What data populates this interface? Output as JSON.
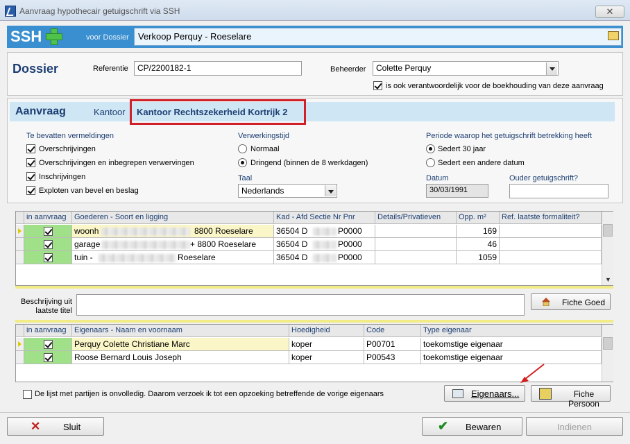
{
  "window": {
    "title": "Aanvraag hypothecair getuigschrift via SSH",
    "close_glyph": "✕"
  },
  "header": {
    "logo": "SSH",
    "voor_label": "voor Dossier",
    "dossier_value": "Verkoop  Perquy - Roeselare"
  },
  "dossier": {
    "title": "Dossier",
    "referentie_label": "Referentie",
    "referentie_value": "CP/2200182-1",
    "beheerder_label": "Beheerder",
    "beheerder_value": "Colette Perquy",
    "boekhouding_label": "is ook verantwoordelijk voor de boekhouding van deze aanvraag",
    "boekhouding_checked": true
  },
  "aanvraag": {
    "title": "Aanvraag",
    "kantoor_label": "Kantoor",
    "kantoor_value": "Kantoor Rechtszekerheid Kortrijk 2",
    "highlight_color": "#d0202a",
    "vermeldingen": {
      "title": "Te bevatten vermeldingen",
      "items": [
        {
          "label": "Overschrijvingen",
          "checked": true
        },
        {
          "label": "Overschrijvingen en inbegrepen verwervingen",
          "checked": true
        },
        {
          "label": "Inschrijvingen",
          "checked": true
        },
        {
          "label": "Exploten van bevel en beslag",
          "checked": true
        }
      ]
    },
    "verwerking": {
      "title": "Verwerkingstijd",
      "options": [
        {
          "label": "Normaal",
          "selected": false
        },
        {
          "label": "Dringend (binnen de 8 werkdagen)",
          "selected": true
        }
      ]
    },
    "taal": {
      "label": "Taal",
      "value": "Nederlands"
    },
    "periode": {
      "title": "Periode waarop het getuigschrift betrekking heeft",
      "options": [
        {
          "label": "Sedert 30 jaar",
          "selected": true
        },
        {
          "label": "Sedert een andere datum",
          "selected": false
        }
      ]
    },
    "datum": {
      "label": "Datum",
      "value": "30/03/1991"
    },
    "ouder": {
      "label": "Ouder getuigschrift?",
      "value": ""
    }
  },
  "goederen": {
    "columns": [
      "in aanvraag",
      "Goederen - Soort en ligging",
      "Kad - Afd Sectie Nr Pnr",
      "Details/Privatieven",
      "Opp. m²",
      "Ref. laatste formaliteit?"
    ],
    "rows": [
      {
        "checked": true,
        "soort": "woonh",
        "ligging": "8800 Roeselare",
        "kad": "36504 D",
        "pnr": "P0000",
        "details": "",
        "opp": "169",
        "ref": "",
        "current": true
      },
      {
        "checked": true,
        "soort": "garage",
        "ligging": "+  8800 Roeselare",
        "kad": "36504 D",
        "pnr": "P0000",
        "details": "",
        "opp": "46",
        "ref": "",
        "current": false
      },
      {
        "checked": true,
        "soort": "tuin  -",
        "ligging": "Roeselare",
        "kad": "36504 D",
        "pnr": "P0000",
        "details": "",
        "opp": "1059",
        "ref": "",
        "current": false
      }
    ]
  },
  "beschrijving": {
    "label_line1": "Beschrijving uit",
    "label_line2": "laatste titel",
    "value": "",
    "fiche_goed": "Fiche Goed"
  },
  "eigenaars": {
    "columns": [
      "in aanvraag",
      "Eigenaars - Naam en voornaam",
      "Hoedigheid",
      "Code",
      "Type eigenaar"
    ],
    "rows": [
      {
        "checked": true,
        "naam": "Perquy Colette Christiane Marc",
        "hoedigheid": "koper",
        "code": "P00701",
        "type": "toekomstige eigenaar",
        "current": true
      },
      {
        "checked": true,
        "naam": "Roose Bernard Louis Joseph",
        "hoedigheid": "koper",
        "code": "P00543",
        "type": "toekomstige eigenaar",
        "current": false
      }
    ],
    "onvolledig_label": "De lijst met partijen is onvolledig. Daarom verzoek ik tot een opzoeking betreffende de vorige eigenaars",
    "onvolledig_checked": false,
    "eigenaars_button": "Eigenaars...",
    "fiche_persoon": "Fiche Persoon"
  },
  "footer": {
    "sluit": "Sluit",
    "bewaren": "Bewaren",
    "indienen": "Indienen"
  }
}
